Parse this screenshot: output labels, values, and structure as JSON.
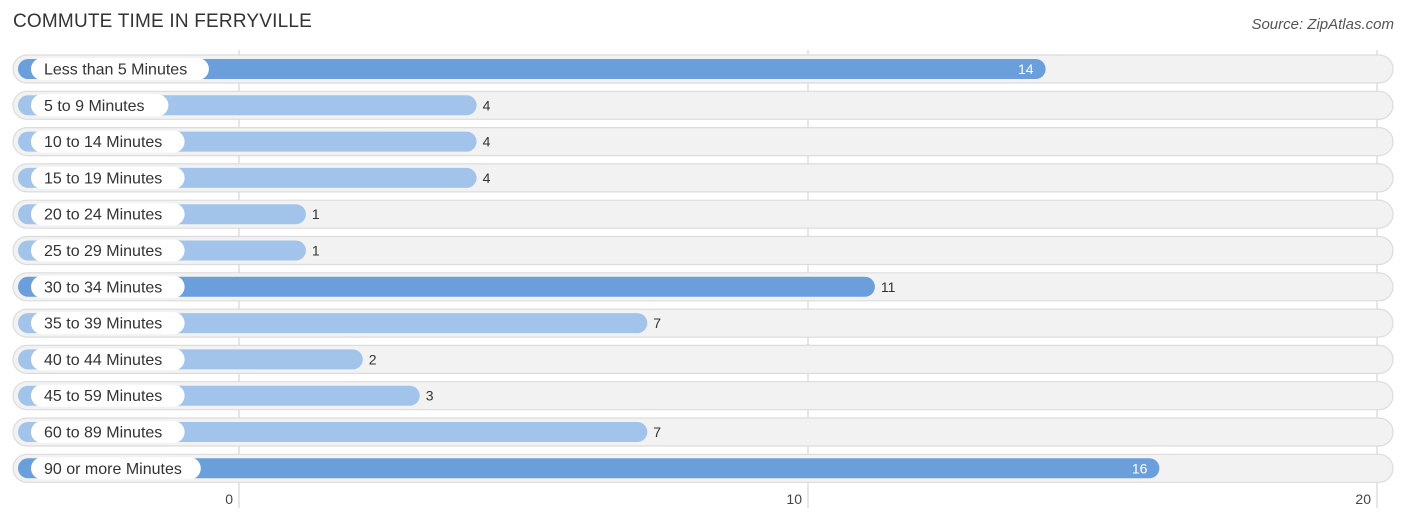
{
  "header": {
    "title": "COMMUTE TIME IN FERRYVILLE",
    "source": "Source: ZipAtlas.com"
  },
  "colors": {
    "bar_strong": "#6a9fdc",
    "bar_light": "#a3c4ea",
    "row_bg": "#f2f2f2",
    "row_border": "#dcdcdc",
    "grid": "#cccccc"
  },
  "chart_data": {
    "type": "bar",
    "orientation": "horizontal",
    "title": "COMMUTE TIME IN FERRYVILLE",
    "xlabel": "",
    "ylabel": "",
    "categories": [
      "Less than 5 Minutes",
      "5 to 9 Minutes",
      "10 to 14 Minutes",
      "15 to 19 Minutes",
      "20 to 24 Minutes",
      "25 to 29 Minutes",
      "30 to 34 Minutes",
      "35 to 39 Minutes",
      "40 to 44 Minutes",
      "45 to 59 Minutes",
      "60 to 89 Minutes",
      "90 or more Minutes"
    ],
    "values": [
      14,
      4,
      4,
      4,
      1,
      1,
      11,
      7,
      2,
      3,
      7,
      16
    ],
    "xlim": [
      0,
      20
    ],
    "xticks": [
      0,
      10,
      20
    ],
    "grid": true
  }
}
